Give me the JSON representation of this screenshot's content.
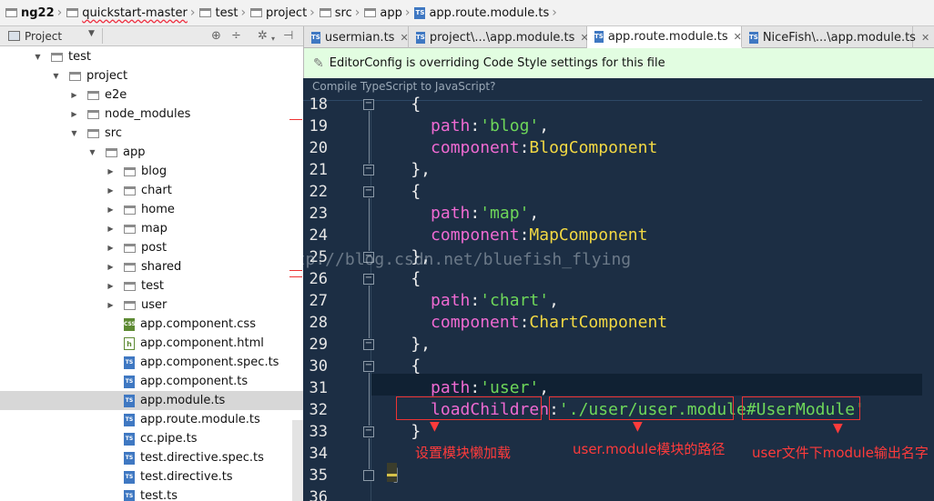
{
  "breadcrumbs": [
    {
      "label": "ng22",
      "icon": "folder-icon"
    },
    {
      "label": "quickstart-master",
      "icon": "folder-icon"
    },
    {
      "label": "test",
      "icon": "folder-icon"
    },
    {
      "label": "project",
      "icon": "folder-icon"
    },
    {
      "label": "src",
      "icon": "folder-icon"
    },
    {
      "label": "app",
      "icon": "folder-icon"
    },
    {
      "label": "app.route.module.ts",
      "icon": "ts-file-icon"
    }
  ],
  "project_panel": {
    "title": "Project",
    "tree": [
      {
        "label": "test",
        "type": "folder",
        "expanded": true
      },
      {
        "label": "project",
        "type": "folder",
        "expanded": true
      },
      {
        "label": "e2e",
        "type": "folder",
        "expanded": false
      },
      {
        "label": "node_modules",
        "type": "folder",
        "expanded": false
      },
      {
        "label": "src",
        "type": "folder",
        "expanded": true
      },
      {
        "label": "app",
        "type": "folder",
        "expanded": true
      },
      {
        "label": "blog",
        "type": "folder",
        "expanded": false
      },
      {
        "label": "chart",
        "type": "folder",
        "expanded": false
      },
      {
        "label": "home",
        "type": "folder",
        "expanded": false
      },
      {
        "label": "map",
        "type": "folder",
        "expanded": false
      },
      {
        "label": "post",
        "type": "folder",
        "expanded": false
      },
      {
        "label": "shared",
        "type": "folder",
        "expanded": false
      },
      {
        "label": "test",
        "type": "folder",
        "expanded": false
      },
      {
        "label": "user",
        "type": "folder",
        "expanded": false
      },
      {
        "label": "app.component.css",
        "type": "css"
      },
      {
        "label": "app.component.html",
        "type": "html"
      },
      {
        "label": "app.component.spec.ts",
        "type": "ts"
      },
      {
        "label": "app.component.ts",
        "type": "ts"
      },
      {
        "label": "app.module.ts",
        "type": "ts",
        "selected": true
      },
      {
        "label": "app.route.module.ts",
        "type": "ts"
      },
      {
        "label": "cc.pipe.ts",
        "type": "ts"
      },
      {
        "label": "test.directive.spec.ts",
        "type": "ts"
      },
      {
        "label": "test.directive.ts",
        "type": "ts"
      },
      {
        "label": "test.ts",
        "type": "ts"
      }
    ]
  },
  "tabs": [
    {
      "label": "usermian.ts",
      "active": false
    },
    {
      "label": "project\\...\\app.module.ts",
      "active": false
    },
    {
      "label": "app.route.module.ts",
      "active": true
    },
    {
      "label": "NiceFish\\...\\app.module.ts",
      "active": false
    }
  ],
  "banner": {
    "text": "EditorConfig is overriding Code Style settings for this file"
  },
  "editor": {
    "compile_prompt": "Compile TypeScript to JavaScript?",
    "lines": [
      {
        "no": "18",
        "parts": [
          {
            "t": "    {",
            "c": "p"
          }
        ]
      },
      {
        "no": "19",
        "parts": [
          {
            "t": "      path",
            "c": "k"
          },
          {
            "t": ":",
            "c": "p"
          },
          {
            "t": "'blog'",
            "c": "s"
          },
          {
            "t": ",",
            "c": "p"
          }
        ]
      },
      {
        "no": "20",
        "parts": [
          {
            "t": "      component",
            "c": "k"
          },
          {
            "t": ":",
            "c": "p"
          },
          {
            "t": "BlogComponent",
            "c": "c"
          }
        ]
      },
      {
        "no": "21",
        "parts": [
          {
            "t": "    },",
            "c": "p"
          }
        ]
      },
      {
        "no": "22",
        "parts": [
          {
            "t": "    {",
            "c": "p"
          }
        ]
      },
      {
        "no": "23",
        "parts": [
          {
            "t": "      path",
            "c": "k"
          },
          {
            "t": ":",
            "c": "p"
          },
          {
            "t": "'map'",
            "c": "s"
          },
          {
            "t": ",",
            "c": "p"
          }
        ]
      },
      {
        "no": "24",
        "parts": [
          {
            "t": "      component",
            "c": "k"
          },
          {
            "t": ":",
            "c": "p"
          },
          {
            "t": "MapComponent",
            "c": "c"
          }
        ]
      },
      {
        "no": "25",
        "parts": [
          {
            "t": "    },",
            "c": "p"
          }
        ]
      },
      {
        "no": "26",
        "parts": [
          {
            "t": "    {",
            "c": "p"
          }
        ]
      },
      {
        "no": "27",
        "parts": [
          {
            "t": "      path",
            "c": "k"
          },
          {
            "t": ":",
            "c": "p"
          },
          {
            "t": "'chart'",
            "c": "s"
          },
          {
            "t": ",",
            "c": "p"
          }
        ]
      },
      {
        "no": "28",
        "parts": [
          {
            "t": "      component",
            "c": "k"
          },
          {
            "t": ":",
            "c": "p"
          },
          {
            "t": "ChartComponent",
            "c": "c"
          }
        ]
      },
      {
        "no": "29",
        "parts": [
          {
            "t": "    },",
            "c": "p"
          }
        ]
      },
      {
        "no": "30",
        "parts": [
          {
            "t": "    {",
            "c": "p"
          }
        ]
      },
      {
        "no": "31",
        "parts": [
          {
            "t": "      path",
            "c": "k"
          },
          {
            "t": ":",
            "c": "p"
          },
          {
            "t": "'user'",
            "c": "s"
          },
          {
            "t": ",",
            "c": "p"
          }
        ]
      },
      {
        "no": "32",
        "parts": [
          {
            "t": "      loadChildren",
            "c": "k"
          },
          {
            "t": ":",
            "c": "p"
          },
          {
            "t": "'./user/user.module#UserModule'",
            "c": "s"
          }
        ]
      },
      {
        "no": "33",
        "parts": [
          {
            "t": "    }",
            "c": "p"
          }
        ]
      },
      {
        "no": "34",
        "parts": []
      },
      {
        "no": "35",
        "parts": [
          {
            "t": "  ]",
            "c": "p"
          }
        ]
      },
      {
        "no": "36",
        "parts": []
      }
    ],
    "watermark": "http://blog.csdn.net/bluefish_flying"
  },
  "annotations": [
    {
      "text": "设置模块懒加载"
    },
    {
      "text": "user.module模块的路径"
    },
    {
      "text": "user文件下module输出名字"
    }
  ],
  "colors": {
    "editor_bg": "#1c2e44",
    "keyword": "#ef6ad2",
    "string": "#6ed75a",
    "class": "#f2d843",
    "banner_bg": "#e2fde1",
    "annotation": "#ff3b3b"
  }
}
